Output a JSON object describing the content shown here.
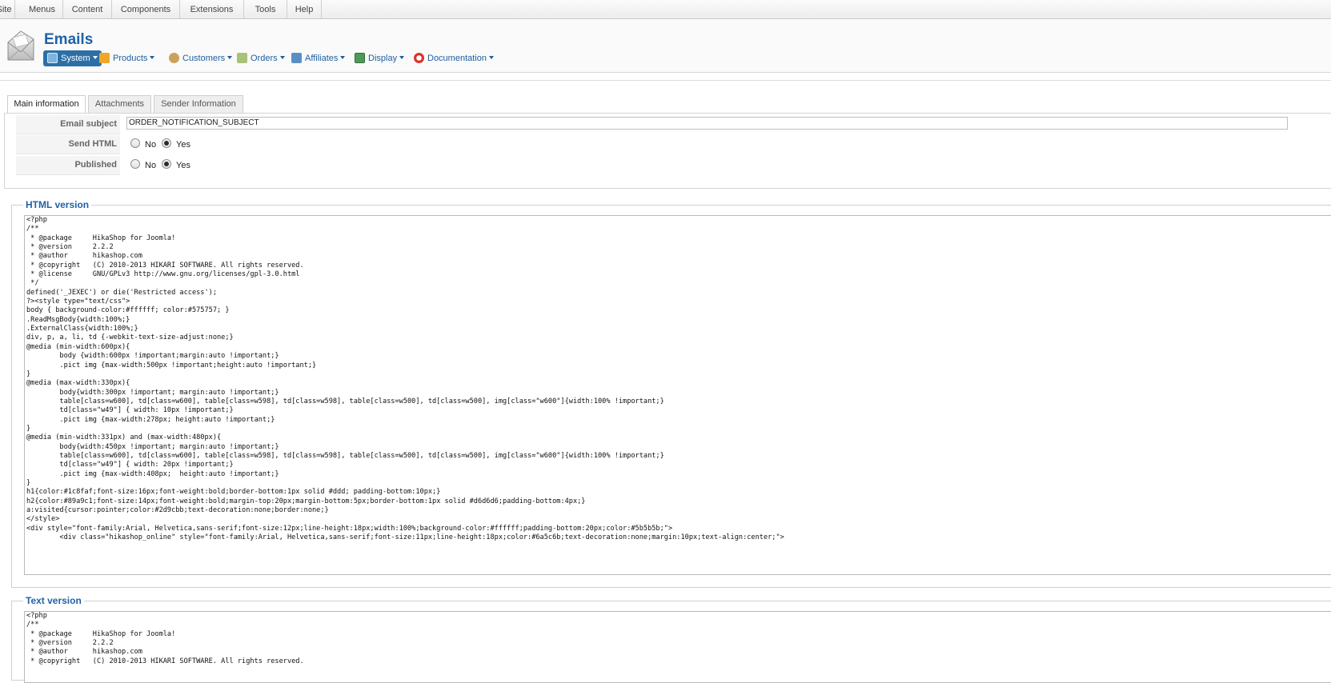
{
  "top_menu": [
    {
      "label": "Site"
    },
    {
      "label": "Menus"
    },
    {
      "label": "Content"
    },
    {
      "label": "Components"
    },
    {
      "label": "Extensions"
    },
    {
      "label": "Tools"
    },
    {
      "label": "Help"
    }
  ],
  "header": {
    "title": "Emails",
    "submenu": [
      {
        "label": "System",
        "icon": "system-icon",
        "active": true
      },
      {
        "label": "Products",
        "icon": "products-icon"
      },
      {
        "label": "Customers",
        "icon": "customers-icon"
      },
      {
        "label": "Orders",
        "icon": "orders-icon"
      },
      {
        "label": "Affiliates",
        "icon": "affiliates-icon"
      },
      {
        "label": "Display",
        "icon": "display-icon"
      },
      {
        "label": "Documentation",
        "icon": "lifebuoy-icon"
      }
    ]
  },
  "tabs": [
    {
      "label": "Main information",
      "active": true
    },
    {
      "label": "Attachments"
    },
    {
      "label": "Sender Information"
    }
  ],
  "form": {
    "subject_label": "Email subject",
    "subject_value": "ORDER_NOTIFICATION_SUBJECT",
    "send_html_label": "Send HTML",
    "published_label": "Published",
    "no_label": "No",
    "yes_label": "Yes",
    "send_html_value": "Yes",
    "published_value": "Yes"
  },
  "html_version": {
    "legend": "HTML version",
    "lines": [
      "<?php",
      "/**",
      " * @package     HikaShop for Joomla!",
      " * @version     2.2.2",
      " * @author      hikashop.com",
      " * @copyright   (C) 2010-2013 HIKARI SOFTWARE. All rights reserved.",
      " * @license     GNU/GPLv3 http://www.gnu.org/licenses/gpl-3.0.html",
      " */",
      "defined('_JEXEC') or die('Restricted access');",
      "?><style type=\"text/css\">",
      "body { background-color:#ffffff; color:#575757; }",
      ".ReadMsgBody{width:100%;}",
      ".ExternalClass{width:100%;}",
      "div, p, a, li, td {-webkit-text-size-adjust:none;}",
      "@media (min-width:600px){",
      "        body {width:600px !important;margin:auto !important;}",
      "        .pict img {max-width:500px !important;height:auto !important;}",
      "}",
      "@media (max-width:330px){",
      "        body{width:300px !important; margin:auto !important;}",
      "        table[class=w600], td[class=w600], table[class=w598], td[class=w598], table[class=w500], td[class=w500], img[class=\"w600\"]{width:100% !important;}",
      "        td[class=\"w49\"] { width: 10px !important;}",
      "        .pict img {max-width:278px; height:auto !important;}",
      "}",
      "@media (min-width:331px) and (max-width:480px){",
      "        body{width:450px !important; margin:auto !important;}",
      "        table[class=w600], td[class=w600], table[class=w598], td[class=w598], table[class=w500], td[class=w500], img[class=\"w600\"]{width:100% !important;}",
      "        td[class=\"w49\"] { width: 20px !important;}",
      "        .pict img {max-width:408px;  height:auto !important;}",
      "}",
      "h1{color:#1c8faf;font-size:16px;font-weight:bold;border-bottom:1px solid #ddd; padding-bottom:10px;}",
      "h2{color:#89a9c1;font-size:14px;font-weight:bold;margin-top:20px;margin-bottom:5px;border-bottom:1px solid #d6d6d6;padding-bottom:4px;}",
      "a:visited{cursor:pointer;color:#2d9cbb;text-decoration:none;border:none;}",
      "</style>",
      "",
      "<div style=\"font-family:Arial, Helvetica,sans-serif;font-size:12px;line-height:18px;width:100%;background-color:#ffffff;padding-bottom:20px;color:#5b5b5b;\">",
      "        <div class=\"hikashop_online\" style=\"font-family:Arial, Helvetica,sans-serif;font-size:11px;line-height:18px;color:#6a5c6b;text-decoration:none;margin:10px;text-align:center;\">"
    ]
  },
  "text_version": {
    "legend": "Text version",
    "lines": [
      "<?php",
      "/**",
      " * @package     HikaShop for Joomla!",
      " * @version     2.2.2",
      " * @author      hikashop.com",
      " * @copyright   (C) 2010-2013 HIKARI SOFTWARE. All rights reserved."
    ]
  }
}
